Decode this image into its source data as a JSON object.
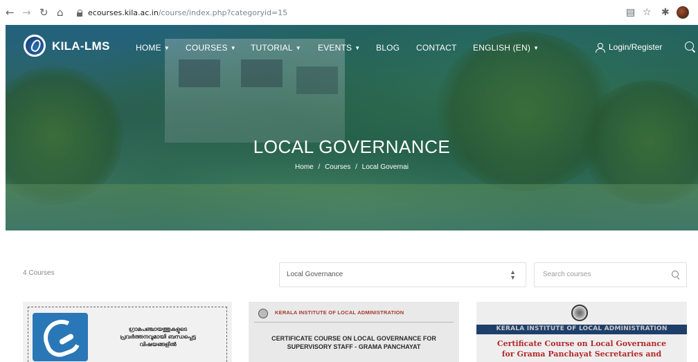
{
  "browser": {
    "url_host": "ecourses.kila.ac.in",
    "url_path": "/course/index.php?categoryid=15"
  },
  "site": {
    "brand": "KILA-LMS",
    "menu": [
      {
        "label": "HOME",
        "dropdown": true
      },
      {
        "label": "COURSES",
        "dropdown": true
      },
      {
        "label": "TUTORIAL",
        "dropdown": true
      },
      {
        "label": "EVENTS",
        "dropdown": true
      },
      {
        "label": "BLOG",
        "dropdown": false
      },
      {
        "label": "CONTACT",
        "dropdown": false
      },
      {
        "label": "ENGLISH (EN)",
        "dropdown": true
      }
    ],
    "login_label": "Login/Register"
  },
  "hero": {
    "title": "LOCAL GOVERNANCE",
    "breadcrumb": [
      "Home",
      "Courses",
      "Local Governai"
    ],
    "breadcrumb_separator": "/"
  },
  "filters": {
    "course_count": "4 Courses",
    "category_value": "Local Governance",
    "search_placeholder": "Search courses"
  },
  "cards": [
    {
      "thumb_text_lines": [
        "ഗ്രാമപഞ്ചായത്തുകളുടെ",
        "പ്രവർത്തനവുമായി ബന്ധപ്പെട്ട",
        "വിഷയങ്ങളിൽ"
      ]
    },
    {
      "header": "KERALA INSTITUTE OF LOCAL ADMINISTRATION",
      "title_lines": [
        "CERTIFICATE COURSE ON LOCAL GOVERNANCE FOR",
        "SUPERVISORY STAFF - GRAMA PANCHAYAT"
      ]
    },
    {
      "banner": "KERALA INSTITUTE OF LOCAL ADMINISTRATION",
      "title_lines": [
        "Certificate Course on Local Governance",
        "for Grama Panchayat Secretaries and"
      ]
    }
  ],
  "colors": {
    "hero_overlay": "#1c698c",
    "card2_header": "#a23a2a",
    "card3_banner": "#1f3f6b",
    "card3_title": "#b5282a"
  }
}
